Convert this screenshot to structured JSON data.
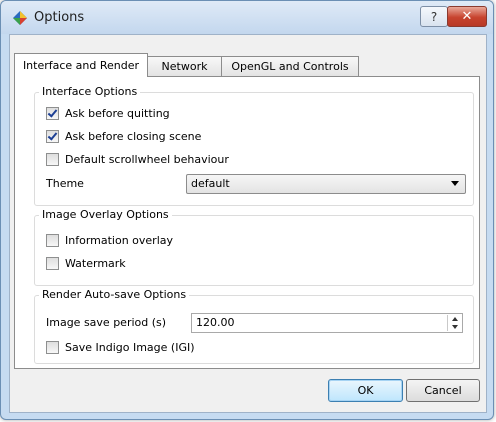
{
  "window": {
    "title": "Options",
    "help_button": "?",
    "close_button": "✕",
    "icon": "diamond-app-icon"
  },
  "tabs": [
    {
      "label": "Interface and Render",
      "active": true
    },
    {
      "label": "Network",
      "active": false
    },
    {
      "label": "OpenGL and Controls",
      "active": false
    }
  ],
  "interface_options": {
    "title": "Interface Options",
    "ask_quit": {
      "label": "Ask before quitting",
      "checked": true
    },
    "ask_close_scene": {
      "label": "Ask before closing scene",
      "checked": true
    },
    "scrollwheel": {
      "label": "Default scrollwheel behaviour",
      "checked": false
    },
    "theme_label": "Theme",
    "theme_value": "default"
  },
  "image_overlay_options": {
    "title": "Image Overlay Options",
    "info_overlay": {
      "label": "Information overlay",
      "checked": false
    },
    "watermark": {
      "label": "Watermark",
      "checked": false
    }
  },
  "render_autosave_options": {
    "title": "Render Auto-save Options",
    "save_period_label": "Image save period (s)",
    "save_period_value": "120.00",
    "save_igi": {
      "label": "Save Indigo Image (IGI)",
      "checked": false
    }
  },
  "buttons": {
    "ok": "OK",
    "cancel": "Cancel"
  },
  "colors": {
    "accent": "#3c7fb1",
    "close_red": "#c7432e",
    "check_mark": "#1c3f94"
  }
}
